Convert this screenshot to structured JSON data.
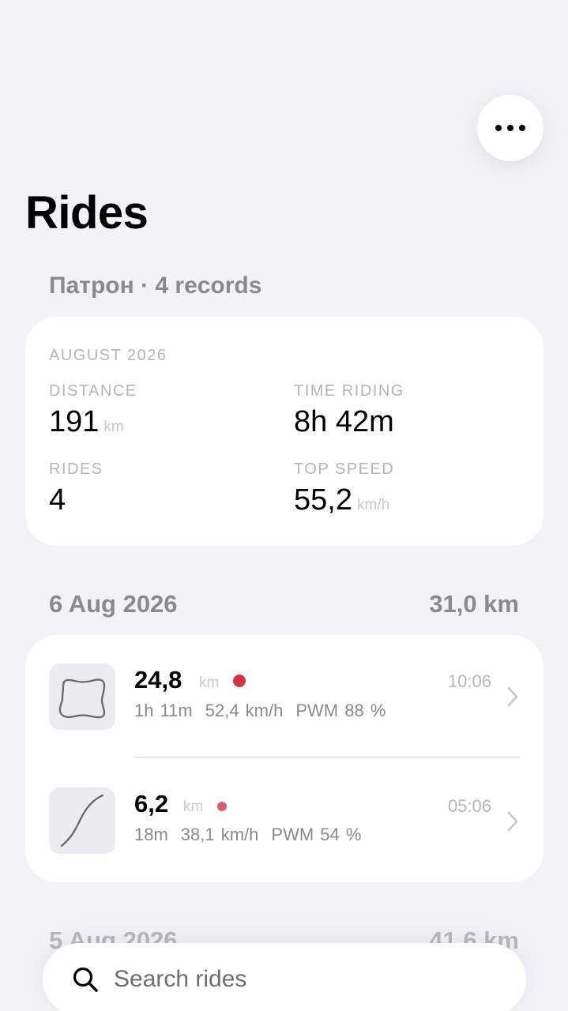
{
  "page_title": "Rides",
  "subtitle": "Патрон · 4 records",
  "summary": {
    "month": "AUGUST 2026",
    "distance_label": "DISTANCE",
    "distance_value": "191",
    "distance_unit": "km",
    "time_label": "TIME RIDING",
    "time_value": "8h 42m",
    "rides_label": "RIDES",
    "rides_value": "4",
    "speed_label": "TOP SPEED",
    "speed_value": "55,2",
    "speed_unit": "km/h"
  },
  "days": [
    {
      "date": "6 Aug 2026",
      "total": "31,0 km",
      "rides": [
        {
          "distance": "24,8",
          "unit": "km",
          "duration": "1h 11m",
          "speed": "52,4 km/h",
          "pwm": "PWM 88 %",
          "time": "10:06",
          "dot_color": "#d13545",
          "track_icon": "loop-track-icon"
        },
        {
          "distance": "6,2",
          "unit": "km",
          "duration": "18m",
          "speed": "38,1 km/h",
          "pwm": "PWM 54 %",
          "time": "05:06",
          "dot_color": "#d95c6f",
          "track_icon": "curve-track-icon"
        }
      ]
    },
    {
      "date": "5 Aug 2026",
      "total": "41,6 km"
    }
  ],
  "search": {
    "placeholder": "Search rides"
  },
  "colors": {
    "background": "#f2f2f7",
    "card": "#ffffff",
    "secondary_text": "#8a8a8e",
    "accent_red": "#d13545"
  }
}
